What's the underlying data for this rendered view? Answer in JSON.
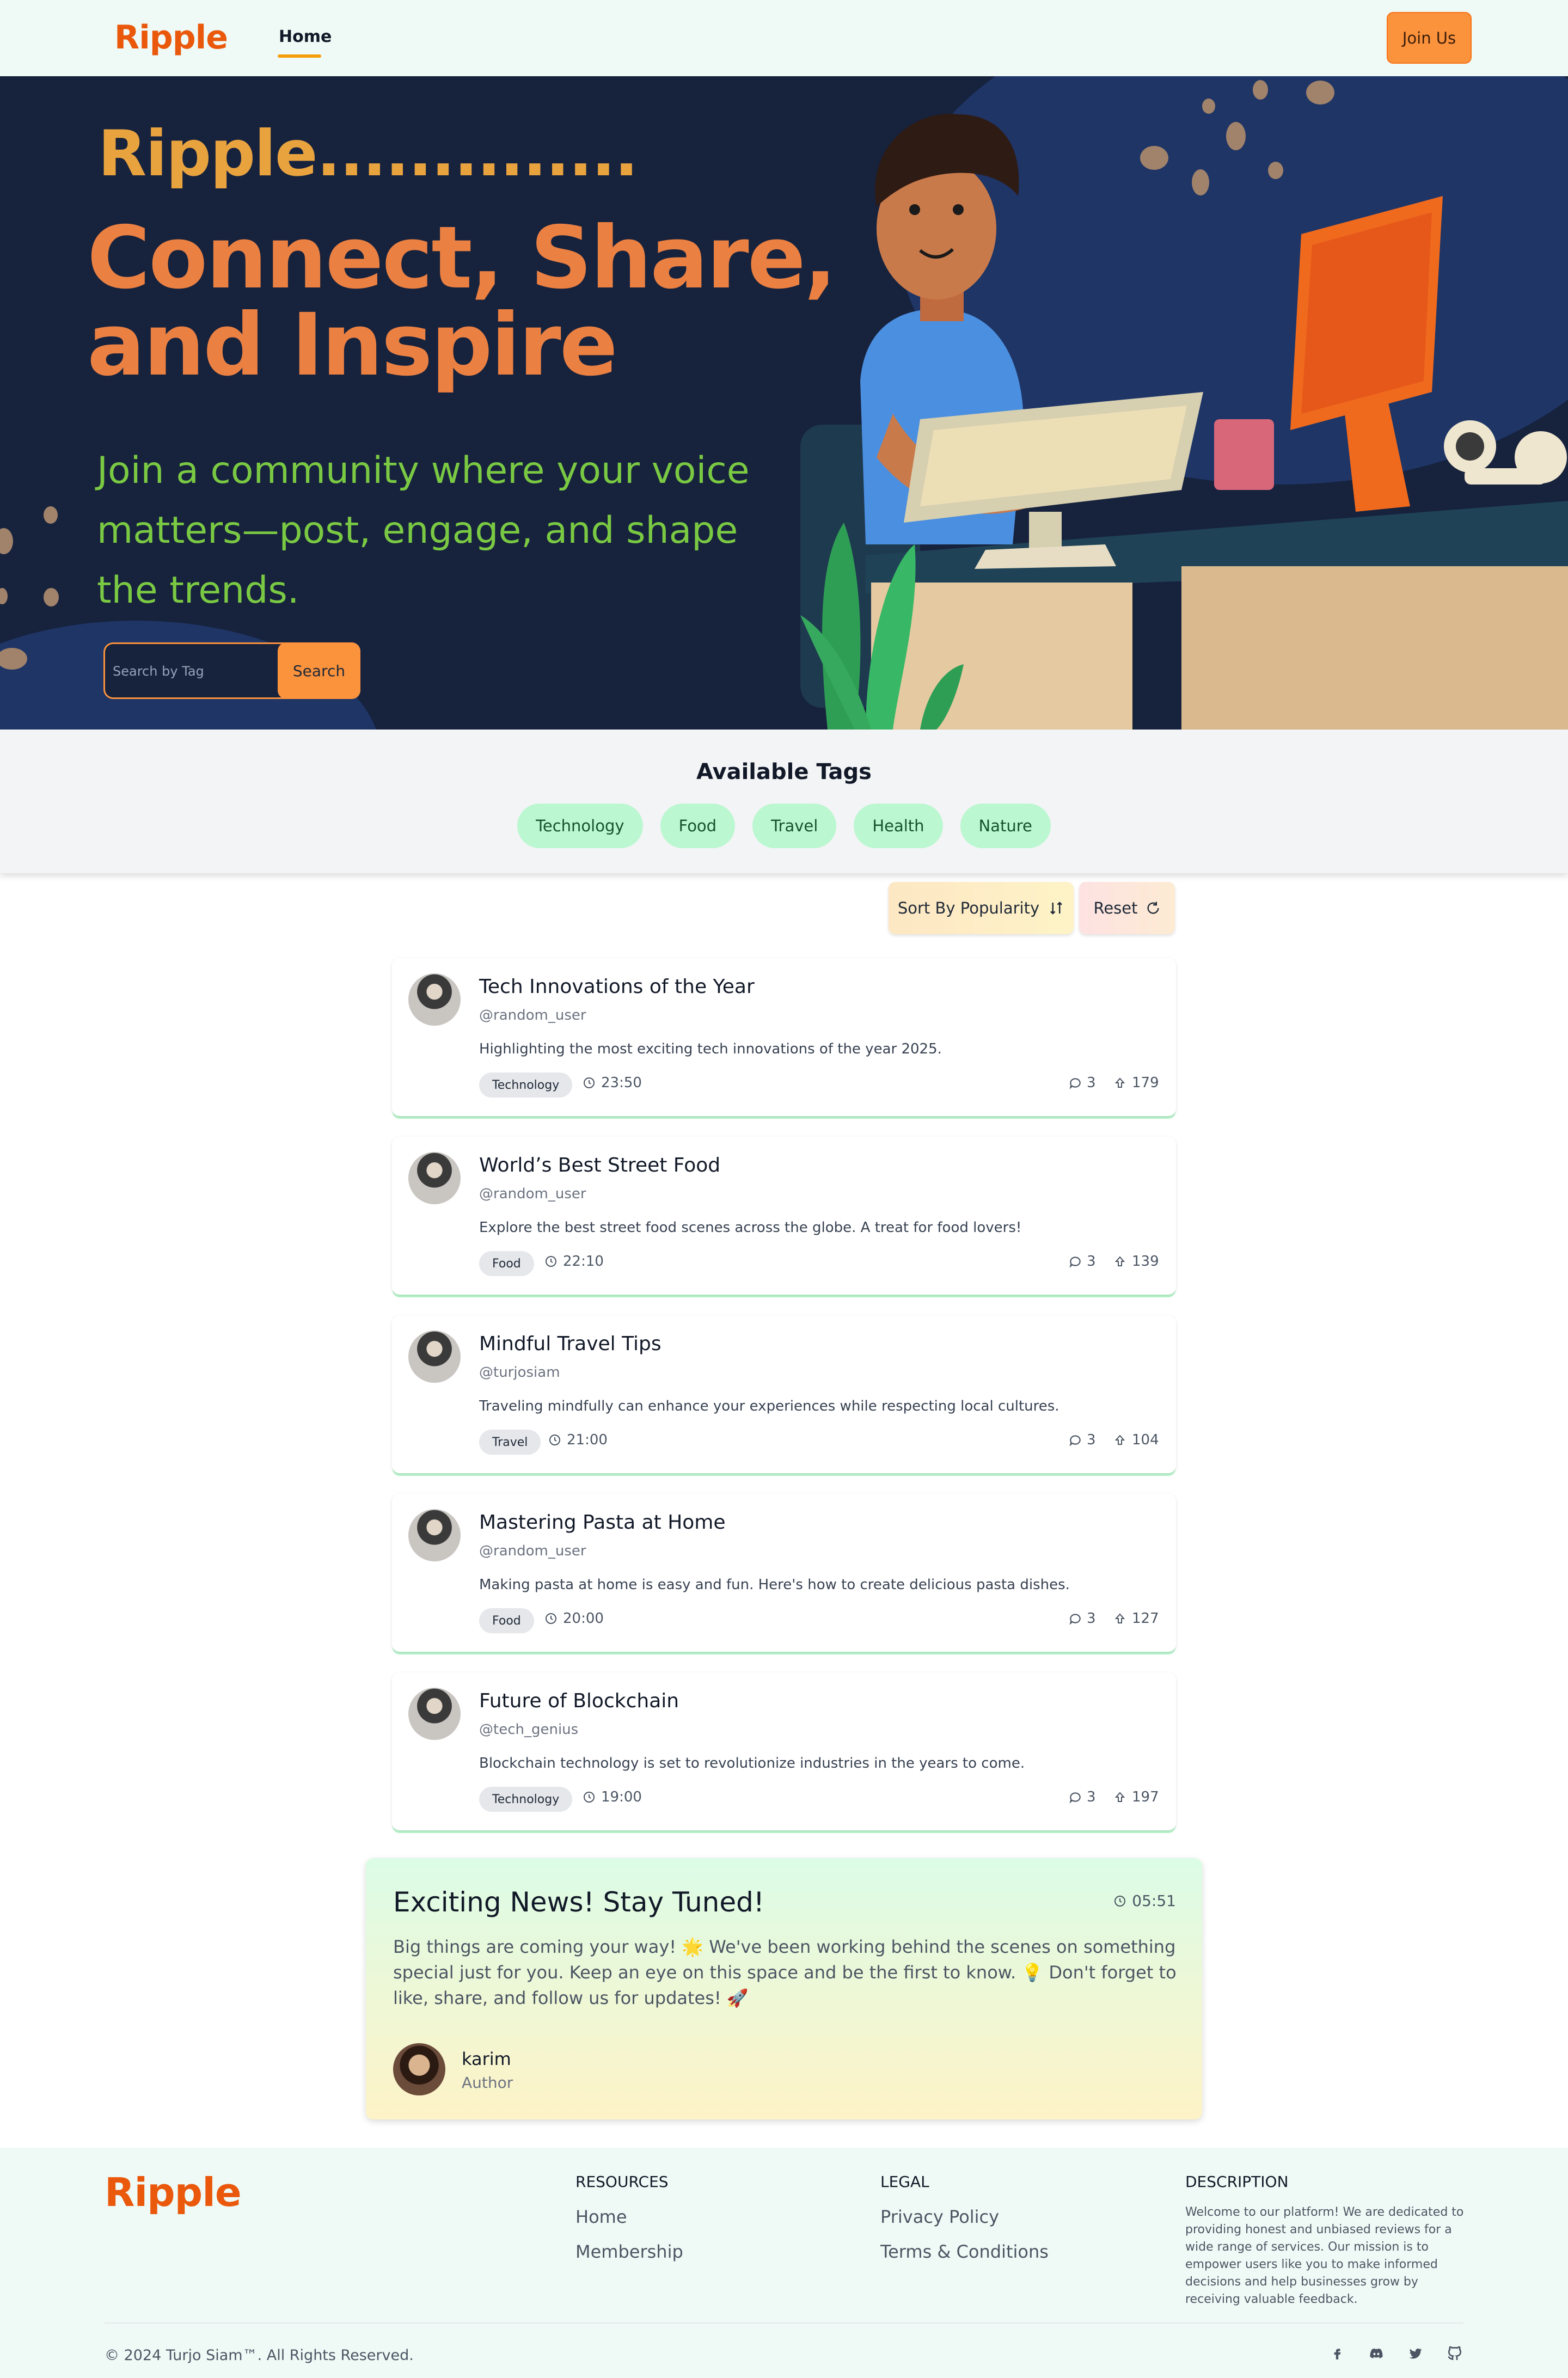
{
  "nav": {
    "logo": "Ripple",
    "home_label": "Home",
    "join_label": "Join Us"
  },
  "hero": {
    "brand": "Ripple..............",
    "headline_line1": "Connect, Share,",
    "headline_line2": "and Inspire",
    "subtitle": "Join a community where your voice matters—post, engage, and shape the trends.",
    "search_placeholder": "Search by Tag",
    "search_button": "Search"
  },
  "tags": {
    "title": "Available Tags",
    "items": [
      "Technology",
      "Food",
      "Travel",
      "Health",
      "Nature"
    ]
  },
  "controls": {
    "sort_label": "Sort By Popularity",
    "reset_label": "Reset"
  },
  "posts": [
    {
      "title": "Tech Innovations of the Year",
      "handle": "@random_user",
      "description": "Highlighting the most exciting tech innovations of the year 2025.",
      "tag": "Technology",
      "time": "23:50",
      "comments": "3",
      "votes": "179"
    },
    {
      "title": "World’s Best Street Food",
      "handle": "@random_user",
      "description": "Explore the best street food scenes across the globe. A treat for food lovers!",
      "tag": "Food",
      "time": "22:10",
      "comments": "3",
      "votes": "139"
    },
    {
      "title": "Mindful Travel Tips",
      "handle": "@turjosiam",
      "description": "Traveling mindfully can enhance your experiences while respecting local cultures.",
      "tag": "Travel",
      "time": "21:00",
      "comments": "3",
      "votes": "104"
    },
    {
      "title": "Mastering Pasta at Home",
      "handle": "@random_user",
      "description": "Making pasta at home is easy and fun. Here's how to create delicious pasta dishes.",
      "tag": "Food",
      "time": "20:00",
      "comments": "3",
      "votes": "127"
    },
    {
      "title": "Future of Blockchain",
      "handle": "@tech_genius",
      "description": "Blockchain technology is set to revolutionize industries in the years to come.",
      "tag": "Technology",
      "time": "19:00",
      "comments": "3",
      "votes": "197"
    }
  ],
  "announcement": {
    "title": "Exciting News! Stay Tuned!",
    "time": "05:51",
    "body": "Big things are coming your way! 🌟 We've been working behind the scenes on something special just for you. Keep an eye on this space and be the first to know. 💡 Don't forget to like, share, and follow us for updates! 🚀",
    "author_name": "karim",
    "author_role": "Author"
  },
  "footer": {
    "logo": "Ripple",
    "resources_title": "RESOURCES",
    "resources_links": [
      "Home",
      "Membership"
    ],
    "legal_title": "LEGAL",
    "legal_links": [
      "Privacy Policy",
      "Terms & Conditions"
    ],
    "description_title": "DESCRIPTION",
    "description": "Welcome to our platform! We are dedicated to providing honest and unbiased reviews for a wide range of services. Our mission is to empower users like you to make informed decisions and help businesses grow by receiving valuable feedback.",
    "copyright": "© 2024 Turjo Siam™. All Rights Reserved.",
    "social_icons": [
      "facebook-icon",
      "discord-icon",
      "twitter-icon",
      "github-icon"
    ]
  },
  "colors": {
    "brand": "#ea580c",
    "accent": "#fb923c",
    "hero_bg": "#17223d",
    "tag_bg": "#bbf7d0",
    "hero_subtitle": "#7ac943"
  }
}
